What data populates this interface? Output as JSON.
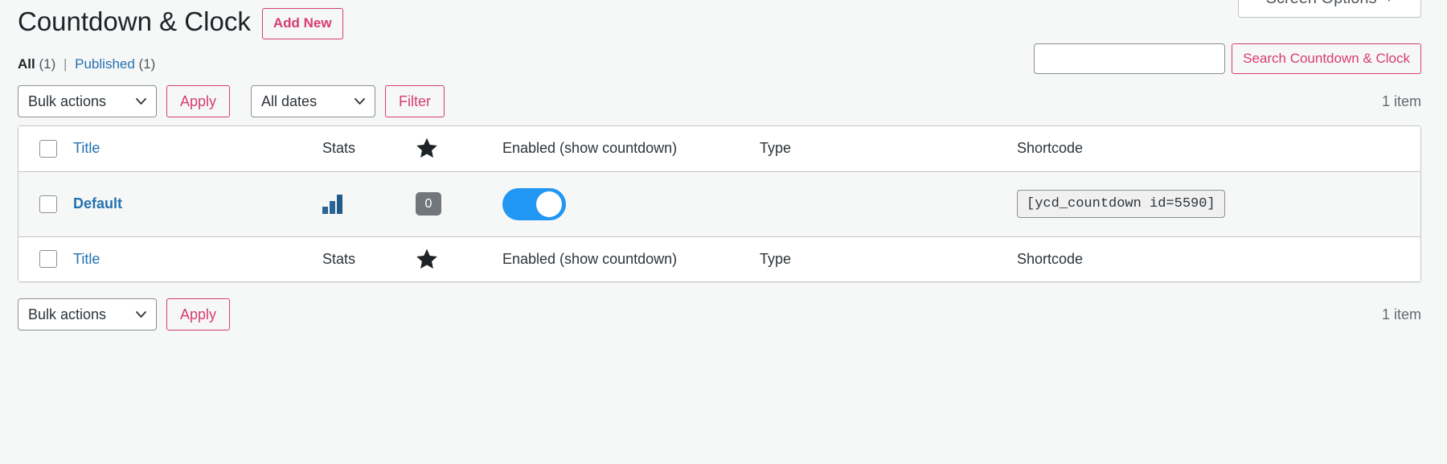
{
  "screen_options": {
    "label": "Screen Options",
    "caret": "▼"
  },
  "header": {
    "page_title": "Countdown & Clock",
    "add_new_label": "Add New"
  },
  "views": {
    "all_label": "All",
    "all_count": "(1)",
    "separator": "|",
    "published_label": "Published",
    "published_count": "(1)"
  },
  "search": {
    "value": "",
    "placeholder": "",
    "submit_label": "Search Countdown & Clock"
  },
  "tablenav_top": {
    "bulk_actions_label": "Bulk actions",
    "apply_label": "Apply",
    "dates_label": "All dates",
    "filter_label": "Filter",
    "displaying_num": "1 item"
  },
  "tablenav_bottom": {
    "bulk_actions_label": "Bulk actions",
    "apply_label": "Apply",
    "displaying_num": "1 item"
  },
  "table": {
    "columns": {
      "title": "Title",
      "stats": "Stats",
      "star": "star-icon",
      "enabled": "Enabled (show countdown)",
      "type": "Type",
      "shortcode": "Shortcode"
    },
    "rows": [
      {
        "title": "Default",
        "stats_icon": "bar-chart-icon",
        "star_count": "0",
        "enabled": true,
        "type": "",
        "shortcode": "[ycd_countdown id=5590]"
      }
    ]
  },
  "colors": {
    "accent_pink": "#d63d72",
    "link_blue": "#2271b1",
    "toggle_on": "#2196f3",
    "badge_gray": "#72777c",
    "stats_blue": "#1d6ca3",
    "page_bg": "#f6f7f7",
    "row_bg": "#f6f7f7",
    "border": "#c3c4c7"
  }
}
